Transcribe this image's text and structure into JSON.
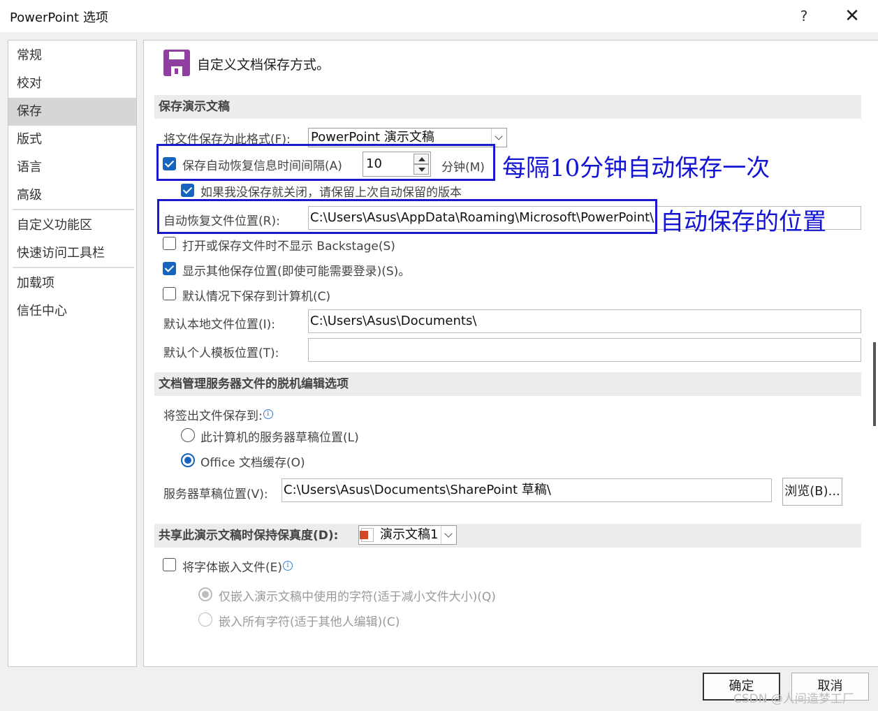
{
  "window": {
    "title": "PowerPoint 选项",
    "help_label": "?",
    "close_label": "✕"
  },
  "nav": {
    "items": [
      {
        "label": "常规"
      },
      {
        "label": "校对"
      },
      {
        "label": "保存"
      },
      {
        "label": "版式"
      },
      {
        "label": "语言"
      },
      {
        "label": "高级"
      },
      {
        "label": "自定义功能区"
      },
      {
        "label": "快速访问工具栏"
      },
      {
        "label": "加载项"
      },
      {
        "label": "信任中心"
      }
    ],
    "active_index": 2
  },
  "main": {
    "heading": "自定义文档保存方式。",
    "section_save": "保存演示文稿",
    "format_label": "将文件保存为此格式(F):",
    "format_value": "PowerPoint 演示文稿",
    "autorecover_label": "保存自动恢复信息时间间隔(A)",
    "autorecover_checked": true,
    "autorecover_minutes": "10",
    "minutes_label": "分钟(M)",
    "keep_last_label": "如果我没保存就关闭，请保留上次自动保留的版本",
    "keep_last_checked": true,
    "autorecover_location_label": "自动恢复文件位置(R):",
    "autorecover_location_value": "C:\\Users\\Asus\\AppData\\Roaming\\Microsoft\\PowerPoint\\",
    "no_backstage_label": "打开或保存文件时不显示 Backstage(S)",
    "no_backstage_checked": false,
    "show_other_label": "显示其他保存位置(即使可能需要登录)(S)。",
    "show_other_checked": true,
    "save_to_computer_label": "默认情况下保存到计算机(C)",
    "save_to_computer_checked": false,
    "default_local_label": "默认本地文件位置(I):",
    "default_local_value": "C:\\Users\\Asus\\Documents\\",
    "default_template_label": "默认个人模板位置(T):",
    "default_template_value": "",
    "section_offline": "文档管理服务器文件的脱机编辑选项",
    "checkout_label": "将签出文件保存到:",
    "radio_server_label": "此计算机的服务器草稿位置(L)",
    "radio_cache_label": "Office 文档缓存(O)",
    "radio_selected": "cache",
    "server_drafts_label": "服务器草稿位置(V):",
    "server_drafts_value": "C:\\Users\\Asus\\Documents\\SharePoint 草稿\\",
    "browse_label": "浏览(B)...",
    "section_fidelity": "共享此演示文稿时保持保真度(D):",
    "fidelity_doc": "演示文稿1",
    "embed_fonts_label": "将字体嵌入文件(E)",
    "embed_fonts_checked": false,
    "embed_used_label": "仅嵌入演示文稿中使用的字符(适于减小文件大小)(Q)",
    "embed_all_label": "嵌入所有字符(适于其他人编辑)(C)"
  },
  "footer": {
    "ok_label": "确定",
    "cancel_label": "取消"
  },
  "annotations": {
    "interval_note": "每隔10分钟自动保存一次",
    "location_note": "自动保存的位置",
    "color": "#1a1acb"
  },
  "watermark": "CSDN @人间造梦工厂"
}
